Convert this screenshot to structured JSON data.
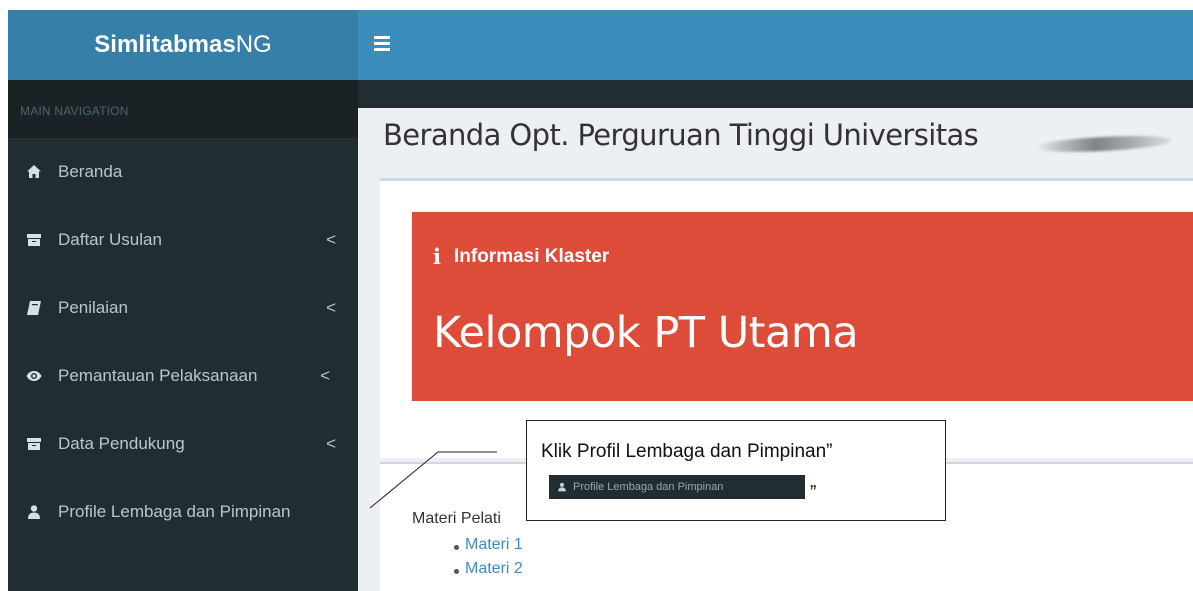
{
  "brand": {
    "bold": "Simlitabmas",
    "light": "NG"
  },
  "sidebar": {
    "header": "MAIN NAVIGATION",
    "items": [
      {
        "label": "Beranda",
        "icon": "home-icon",
        "has_caret": false
      },
      {
        "label": "Daftar Usulan",
        "icon": "archive-icon",
        "has_caret": true
      },
      {
        "label": "Penilaian",
        "icon": "book-icon",
        "has_caret": true
      },
      {
        "label": "Pemantauan Pelaksanaan",
        "icon": "eye-icon",
        "has_caret": true
      },
      {
        "label": "Data Pendukung",
        "icon": "archive-icon",
        "has_caret": true
      },
      {
        "label": "Profile Lembaga dan Pimpinan",
        "icon": "user-icon",
        "has_caret": false
      }
    ],
    "caret": "<"
  },
  "header": {
    "toggle_icon": "hamburger-icon"
  },
  "page": {
    "title": "Beranda Opt. Perguruan Tinggi Universitas"
  },
  "callout": {
    "icon": "i",
    "heading": "Informasi Klaster",
    "value": "Kelompok PT Utama"
  },
  "materi": {
    "label": "Materi Pelati",
    "items": [
      "Materi 1",
      "Materi 2"
    ]
  },
  "annotation": {
    "text": "Klik Profil Lembaga dan Pimpinan”",
    "button_label": "Profile Lembaga dan Pimpinan",
    "closing_quote": "„"
  },
  "colors": {
    "sidebar_bg": "#222d32",
    "brand_bg": "#367fa9",
    "header_bg": "#3c8dbc",
    "callout_bg": "#dd4b39",
    "link": "#3c8dbc"
  }
}
